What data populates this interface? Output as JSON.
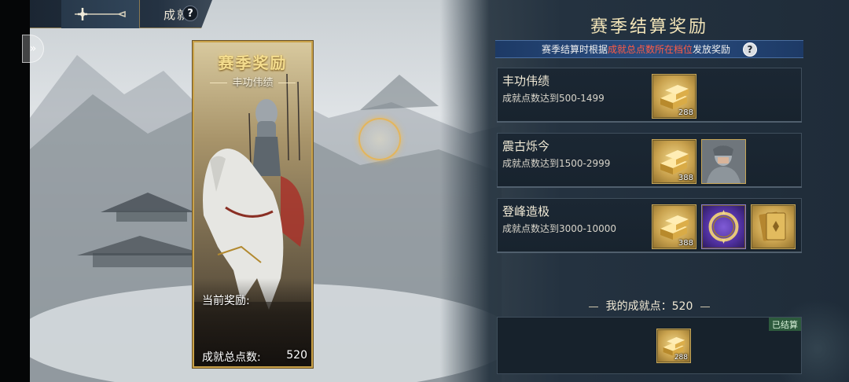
{
  "nav": {
    "title": "成就",
    "help": "?",
    "side_toggle": "»"
  },
  "card": {
    "title": "赛季奖励",
    "subtitle": "丰功伟绩",
    "current_reward_label": "当前奖励:",
    "total_points_label": "成就总点数:",
    "total_points_value": "520"
  },
  "panel": {
    "title": "赛季结算奖励",
    "info": {
      "prefix": "赛季结算时根据",
      "highlight": "成就总点数所在档位",
      "suffix": "发放奖励",
      "help": "?"
    },
    "tiers": [
      {
        "name": "丰功伟绩",
        "desc": "成就点数达到500-1499",
        "items": [
          {
            "icon": "gold-bars-icon",
            "qty": "288"
          }
        ]
      },
      {
        "name": "震古烁今",
        "desc": "成就点数达到1500-2999",
        "items": [
          {
            "icon": "gold-bars-icon",
            "qty": "388"
          },
          {
            "icon": "knight-portrait-icon",
            "qty": ""
          }
        ]
      },
      {
        "name": "登峰造极",
        "desc": "成就点数达到3000-10000",
        "items": [
          {
            "icon": "gold-bars-icon",
            "qty": "388"
          },
          {
            "icon": "avatar-frame-icon",
            "qty": ""
          },
          {
            "icon": "card-pack-icon",
            "qty": ""
          }
        ]
      }
    ],
    "my_points": "我的成就点：520",
    "settled": {
      "tag": "已结算",
      "item_icon": "gold-bars-icon",
      "qty": "288"
    }
  },
  "colors": {
    "accent_gold": "#c9a24a",
    "highlight_red": "#ff5b45",
    "info_bar_blue": "#2a4d80",
    "settled_green": "#2d5a3d"
  }
}
